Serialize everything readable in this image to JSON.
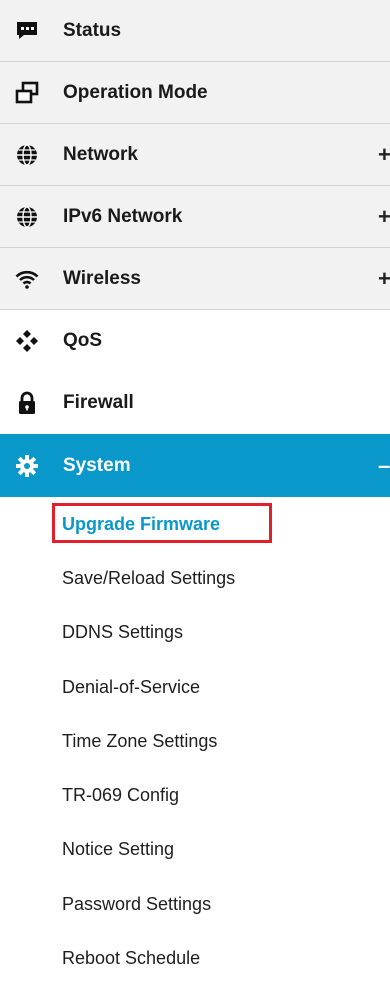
{
  "menu": [
    {
      "label": "Status",
      "icon": "chat-icon",
      "expander": ""
    },
    {
      "label": "Operation Mode",
      "icon": "windows-icon",
      "expander": ""
    },
    {
      "label": "Network",
      "icon": "globe-icon",
      "expander": "+"
    },
    {
      "label": "IPv6 Network",
      "icon": "globe-icon",
      "expander": "+"
    },
    {
      "label": "Wireless",
      "icon": "wifi-icon",
      "expander": "+"
    },
    {
      "label": "QoS",
      "icon": "qos-icon",
      "expander": ""
    },
    {
      "label": "Firewall",
      "icon": "lock-icon",
      "expander": ""
    },
    {
      "label": "System",
      "icon": "gear-icon",
      "expander": "–"
    }
  ],
  "system_submenu": [
    "Upgrade Firmware",
    "Save/Reload Settings",
    "DDNS Settings",
    "Denial-of-Service",
    "Time Zone Settings",
    "TR-069 Config",
    "Notice Setting",
    "Password Settings",
    "Reboot Schedule"
  ],
  "colors": {
    "accent": "#0a97c9",
    "highlight_border": "#e0202a"
  }
}
